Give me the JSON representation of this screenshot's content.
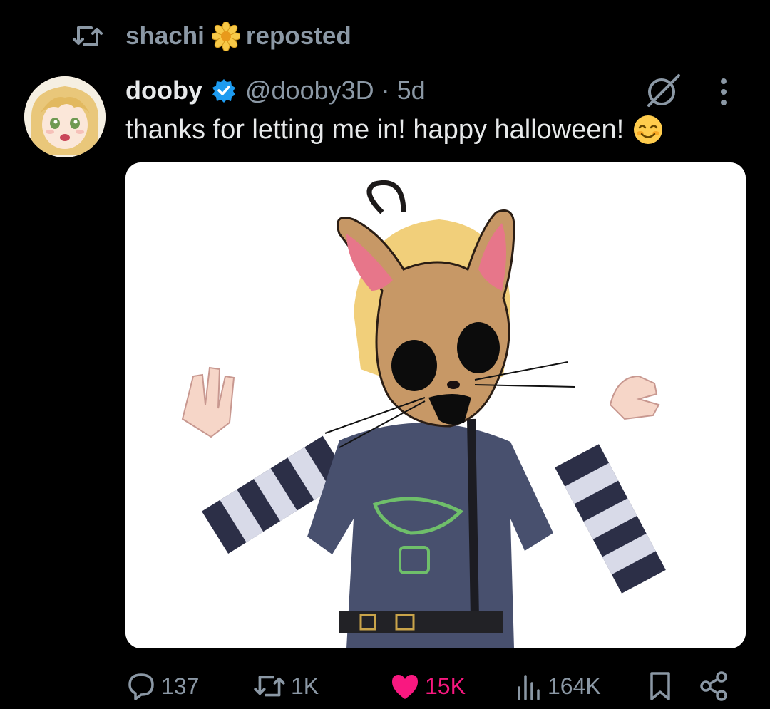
{
  "repost": {
    "user": "shachi",
    "label": "reposted",
    "icon": "repost-icon",
    "badge_icon": "flower-icon"
  },
  "post": {
    "display_name": "dooby",
    "handle": "@dooby3D",
    "separator": "·",
    "time": "5d",
    "verified_icon": "verified-badge-icon",
    "text": "thanks for letting me in! happy halloween!",
    "emoji": "smiling-face-emoji",
    "media_description_icon": "character-image"
  },
  "actions": {
    "replies": "137",
    "reposts": "1K",
    "likes": "15K",
    "views": "164K",
    "bookmark_icon": "bookmark-icon",
    "share_icon": "share-icon"
  },
  "colors": {
    "background": "#000000",
    "text_primary": "#e7e9ea",
    "text_secondary": "#8b98a5",
    "like_pink": "#f91880",
    "verified_blue": "#1d9bf0",
    "flower_yellow": "#f7c948"
  }
}
